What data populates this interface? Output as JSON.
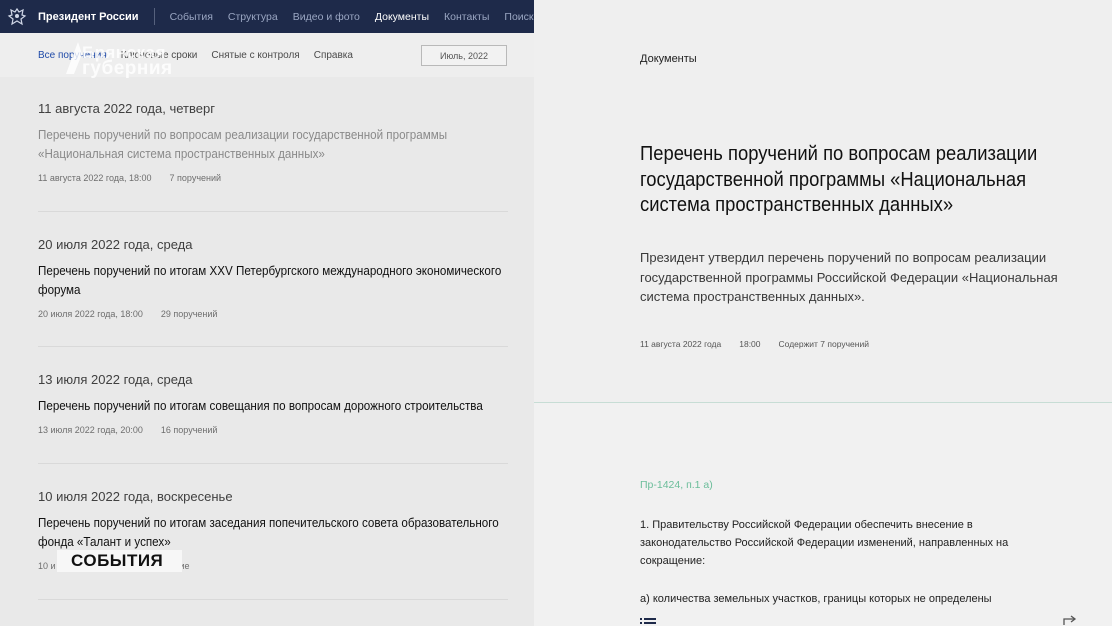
{
  "header": {
    "site_title": "Президент России",
    "nav": [
      "События",
      "Структура",
      "Видео и фото",
      "Документы",
      "Контакты",
      "Поиск"
    ],
    "active_nav": "Документы"
  },
  "filters": {
    "items": [
      "Все поручения",
      "Ключевые сроки",
      "Снятые с контроля",
      "Справка"
    ],
    "month_button": "Июль, 2022"
  },
  "watermark": {
    "line1": "Брянская",
    "line2": "губерния"
  },
  "entries": [
    {
      "date": "11 августа 2022 года, четверг",
      "title": "Перечень поручений по вопросам реализации государственной программы «Национальная система пространственных данных»",
      "time": "11 августа 2022 года, 18:00",
      "count": "7 поручений"
    },
    {
      "date": "20 июля 2022 года, среда",
      "title": "Перечень поручений по итогам XXV Петербургского международного экономического форума",
      "time": "20 июля 2022 года, 18:00",
      "count": "29 поручений"
    },
    {
      "date": "13 июля 2022 года, среда",
      "title": "Перечень поручений по итогам совещания по вопросам дорожного строительства",
      "time": "13 июля 2022 года, 20:00",
      "count": "16 поручений"
    },
    {
      "date": "10 июля 2022 года, воскресенье",
      "title": "Перечень поручений по итогам заседания попечительского совета образовательного фонда «Талант и успех»",
      "time": "10 и",
      "count": "поручение"
    }
  ],
  "events_tag": "СОБЫТИЯ",
  "detail": {
    "section": "Документы",
    "heading": "Перечень поручений по вопросам реализации государственной программы «Национальная система пространственных данных»",
    "lead": "Президент утвердил перечень поручений по вопросам реализации государственной программы Российской Федерации «Национальная система пространственных данных».",
    "date": "11 августа 2022 года",
    "time": "18:00",
    "contains": "Содержит 7 поручений",
    "ref": "Пр-1424, п.1 а)",
    "body": "1. Правительству Российской Федерации обеспечить внесение в законодательство Российской Федерации изменений, направленных на сокращение:",
    "sub": "а) количества земельных участков, границы которых не определены"
  },
  "colors": {
    "topbar": "#1e2a4a",
    "link_selected": "#1f4aa8",
    "ref_green": "#6bbd9a"
  }
}
